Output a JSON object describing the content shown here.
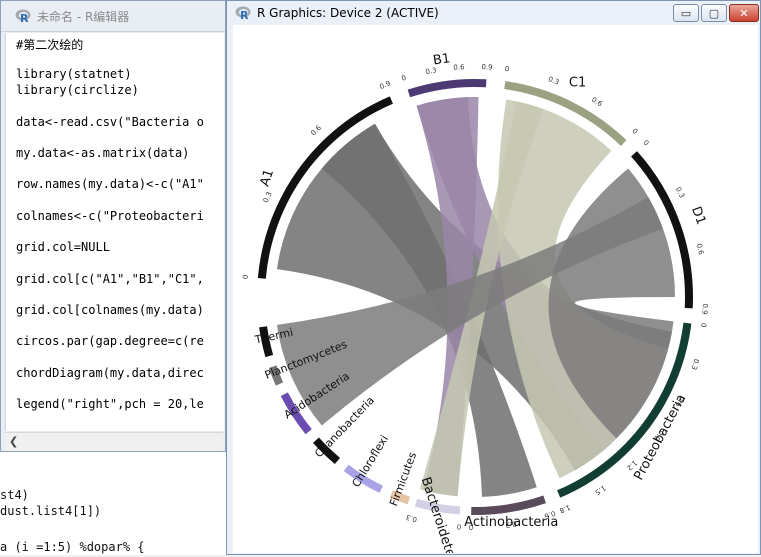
{
  "console": {
    "lines": [
      "st4)",
      "dust.list4[1])",
      "a (i =1:5) %dopar% {"
    ]
  },
  "editor": {
    "title": "未命名 - R编辑器",
    "code_lines": [
      "#第二次绘的",
      "",
      "library(statnet)",
      "library(circlize)",
      "",
      "data<-read.csv(\"Bacteria o",
      "",
      "my.data<-as.matrix(data)",
      "",
      "row.names(my.data)<-c(\"A1\"",
      "",
      "colnames<-c(\"Proteobacteri",
      "",
      "grid.col=NULL",
      "",
      "grid.col[c(\"A1\",\"B1\",\"C1\",",
      "",
      "grid.col[colnames(my.data)",
      "",
      "circos.par(gap.degree=c(re",
      "",
      "chordDiagram(my.data,direc",
      "",
      "legend(\"right\",pch = 20,le"
    ]
  },
  "graphics": {
    "title": "R Graphics: Device 2 (ACTIVE)",
    "buttons": {
      "minimize": "▭",
      "maximize": "▢",
      "close": "✕"
    }
  },
  "plot": {
    "sectors": [
      {
        "name": "A1",
        "color": "#111111",
        "ticks": [
          "0",
          "0.3",
          "0.6",
          "0.9"
        ]
      },
      {
        "name": "B1",
        "color": "#4e3a73",
        "ticks": [
          "0",
          "0.3",
          "0.6",
          "0.9"
        ]
      },
      {
        "name": "C1",
        "color": "#9aa283",
        "ticks": [
          "0",
          "0.3",
          "0.6",
          "0"
        ]
      },
      {
        "name": "D1",
        "color": "#111111",
        "ticks": [
          "0",
          "0.3",
          "0.6",
          "0.9"
        ]
      },
      {
        "name": "Proteobacteria",
        "color": "#123d33",
        "ticks": [
          "0",
          "0.3",
          "0.6",
          "0.9",
          "1.2",
          "1.5",
          "1.8"
        ]
      },
      {
        "name": "Actinobacteria",
        "color": "#5a4a5c",
        "ticks": [
          "0.6",
          "0.3",
          "0"
        ]
      },
      {
        "name": "Bacteroidetes",
        "color": "#d4cfe4",
        "ticks": [
          "0",
          "0.3"
        ]
      },
      {
        "name": "Firmicutes",
        "color": "#e7c4a4",
        "ticks": []
      },
      {
        "name": "Chloroflexi",
        "color": "#a8a2e6",
        "ticks": []
      },
      {
        "name": "Cyanobacteria",
        "color": "#111111",
        "ticks": []
      },
      {
        "name": "Acidobacteria",
        "color": "#6b4cb0",
        "ticks": []
      },
      {
        "name": "Planctomycetes",
        "color": "#777777",
        "ticks": []
      },
      {
        "name": "Thermi",
        "color": "#111111",
        "ticks": []
      }
    ],
    "chord_colors": {
      "A1": "#6f6f6f",
      "B1": "#9a86a8",
      "C1": "#c5c8b1",
      "D1": "#7b7b7b"
    }
  }
}
